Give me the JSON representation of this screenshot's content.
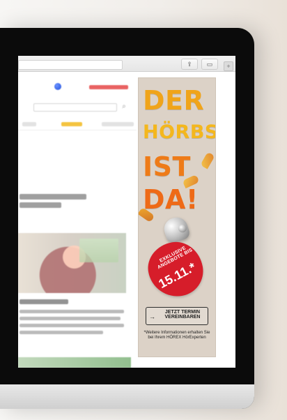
{
  "browser": {
    "share_icon": "share-icon",
    "tabs_icon": "tabs-icon",
    "plus_icon": "plus-icon"
  },
  "ad": {
    "lines": [
      "DER",
      "HÖRBST",
      "IST",
      "DA!"
    ],
    "badge_small": "EXKLUSIVE ANGEBOTE BIS",
    "badge_date": "15.11.*",
    "cta": "JETZT TERMIN VEREINBAREN",
    "cta_arrow": "→",
    "footnote": "*Weitere Informationen erhalten Sie bei Ihrem HÖREX HörExperten"
  },
  "colors": {
    "ad_background": "#dcd2c7",
    "badge_red": "#d61d2a",
    "headline_orange": "#ee7b18"
  }
}
